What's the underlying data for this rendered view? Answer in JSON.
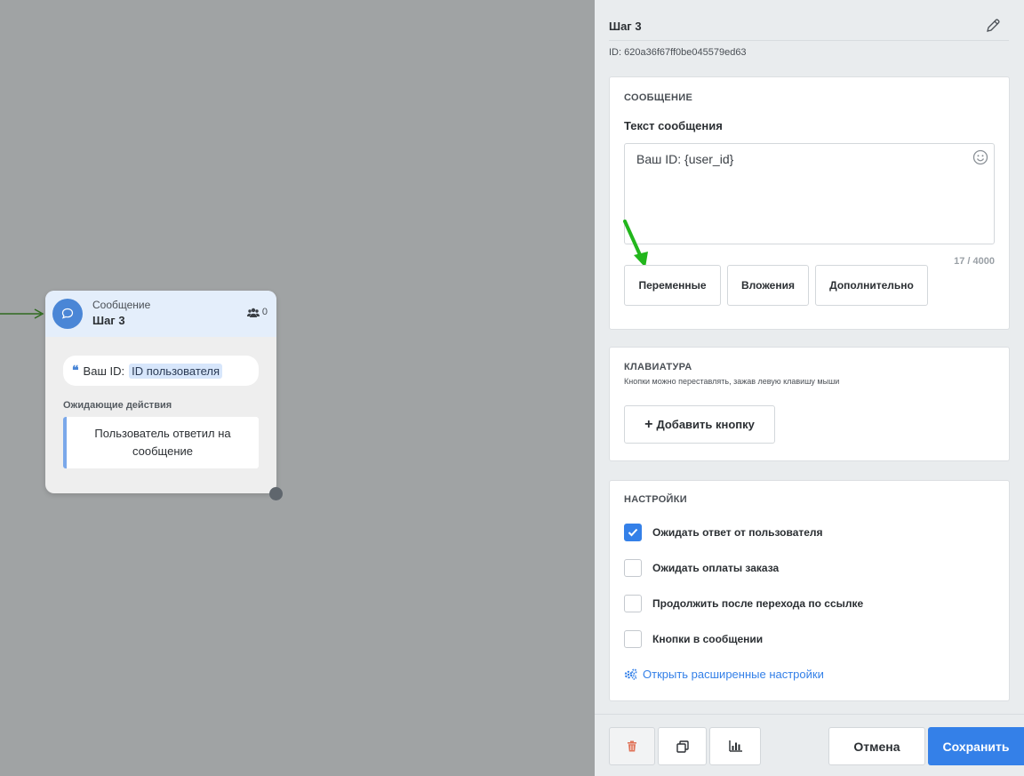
{
  "node": {
    "type": "Сообщение",
    "title": "Шаг 3",
    "count": "0",
    "message_prefix": "Ваш ID:",
    "message_variable": "ID пользователя",
    "pending_label": "Ожидающие действия",
    "pending_action": "Пользователь ответил на сообщение"
  },
  "panel": {
    "title": "Шаг 3",
    "id": "ID: 620a36f67ff0be045579ed63",
    "message": {
      "heading": "СООБЩЕНИЕ",
      "label": "Текст сообщения",
      "text": "Ваш ID: {user_id}",
      "char_count": "17 / 4000",
      "buttons": {
        "variables": "Переменные",
        "attachments": "Вложения",
        "more": "Дополнительно"
      }
    },
    "keyboard": {
      "heading": "КЛАВИАТУРА",
      "hint": "Кнопки можно переставлять, зажав левую клавишу мыши",
      "add_button": "Добавить кнопку"
    },
    "settings": {
      "heading": "НАСТРОЙКИ",
      "options": [
        {
          "label": "Ожидать ответ от пользователя",
          "checked": true
        },
        {
          "label": "Ожидать оплаты заказа",
          "checked": false
        },
        {
          "label": "Продолжить после перехода по ссылке",
          "checked": false
        },
        {
          "label": "Кнопки в сообщении",
          "checked": false
        }
      ],
      "advanced_link": "Открыть расширенные настройки"
    },
    "footer": {
      "cancel": "Отмена",
      "save": "Сохранить"
    }
  },
  "colors": {
    "accent": "#3480e8",
    "canvas": "#a0a3a4",
    "node_header": "#e4eefb",
    "delete_icon": "#e0745a",
    "annotation_arrow": "#22b61c"
  }
}
